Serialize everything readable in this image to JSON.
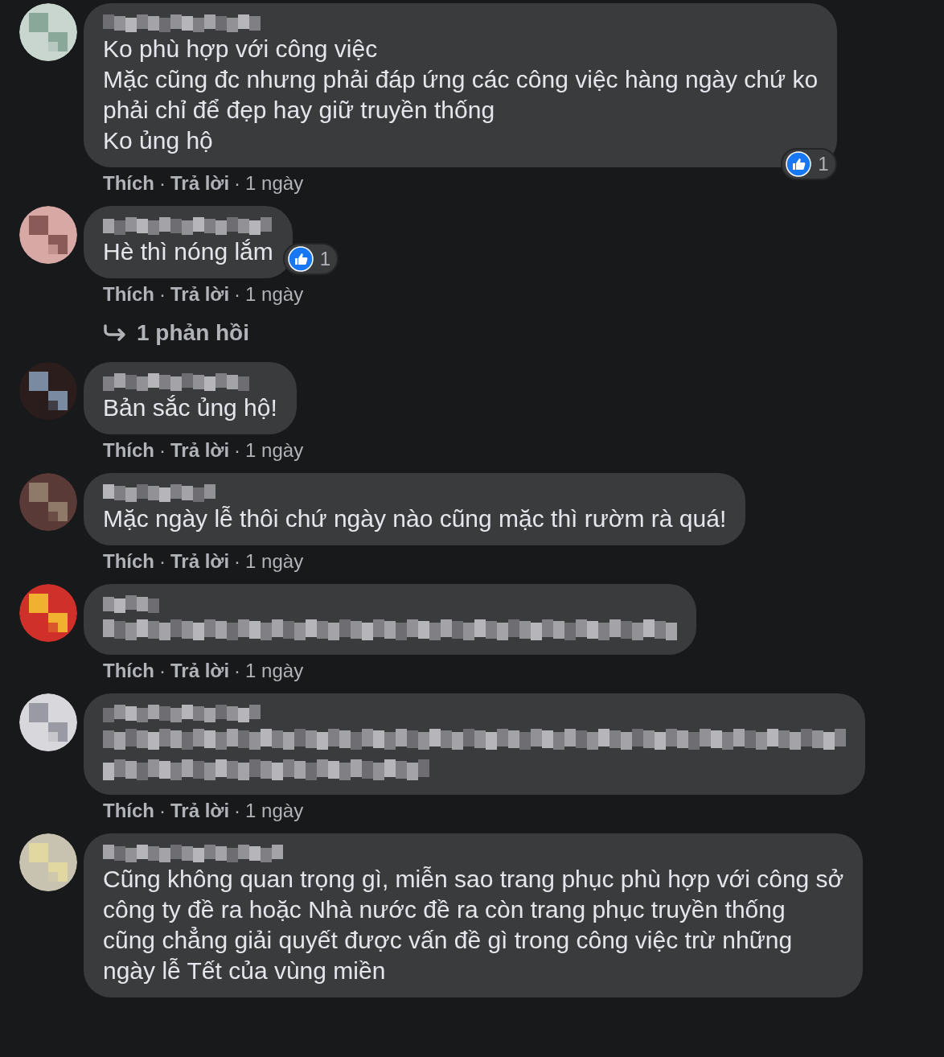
{
  "comments": [
    {
      "kind": "text",
      "lines": [
        "Ko phù hợp với công việc",
        "Mặc cũng đc nhưng phải đáp ứng các công việc hàng ngày chứ ko",
        "phải chỉ để đẹp hay giữ truyền thống",
        "Ko ủng hộ"
      ],
      "reaction_count": "1",
      "actions": {
        "like": "Thích",
        "sep1": "·",
        "reply": "Trả lời",
        "sep2": "·",
        "time": "1 ngày"
      }
    },
    {
      "kind": "text",
      "lines": [
        "Hè thì nóng lắm"
      ],
      "reaction_count": "1",
      "actions": {
        "like": "Thích",
        "sep1": "·",
        "reply": "Trả lời",
        "sep2": "·",
        "time": "1 ngày"
      },
      "replies": "1 phản hồi"
    },
    {
      "kind": "text",
      "lines": [
        "Bản sắc ủng hộ!"
      ],
      "actions": {
        "like": "Thích",
        "sep1": "·",
        "reply": "Trả lời",
        "sep2": "·",
        "time": "1 ngày"
      }
    },
    {
      "kind": "text",
      "lines": [
        "Mặc ngày lễ thôi chứ ngày nào cũng mặc thì rườm rà quá!"
      ],
      "actions": {
        "like": "Thích",
        "sep1": "·",
        "reply": "Trả lời",
        "sep2": "·",
        "time": "1 ngày"
      }
    },
    {
      "kind": "blurred",
      "actions": {
        "like": "Thích",
        "sep1": "·",
        "reply": "Trả lời",
        "sep2": "·",
        "time": "1 ngày"
      }
    },
    {
      "kind": "blurred",
      "actions": {
        "like": "Thích",
        "sep1": "·",
        "reply": "Trả lời",
        "sep2": "·",
        "time": "1 ngày"
      }
    },
    {
      "kind": "text",
      "lines": [
        "Cũng không quan trọng gì, miễn sao trang phục phù hợp với công sở",
        "công ty đề ra hoặc Nhà nước đề ra còn trang phục truyền thống",
        "cũng chẳng giải quyết được vấn đề gì trong công việc trừ những",
        "ngày lễ Tết của vùng miền"
      ]
    }
  ]
}
